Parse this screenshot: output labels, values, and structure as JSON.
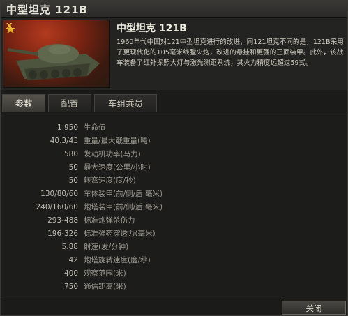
{
  "window": {
    "title": "中型坦克 121B"
  },
  "header": {
    "badge_text": "X",
    "tank_name": "中型坦克 121B",
    "description": "1960年代中国对121中型坦克进行的改进，同121坦克不同的是，121B采用了更现代化的105毫米线膛火炮，改进的悬挂和更强的正面装甲。此外，该战车装备了红外探照大灯与激光测距系统，其火力精度远超过59式。"
  },
  "tabs": [
    {
      "label": "参数"
    },
    {
      "label": "配置"
    },
    {
      "label": "车组乘员"
    }
  ],
  "stats": [
    {
      "value": "1,950",
      "label": "生命值"
    },
    {
      "value": "40.3/43",
      "label": "重量/最大载重量(吨)"
    },
    {
      "value": "580",
      "label": "发动机功率(马力)"
    },
    {
      "value": "50",
      "label": "最大速度(公里/小时)"
    },
    {
      "value": "50",
      "label": "转弯速度(度/秒)"
    },
    {
      "value": "130/80/60",
      "label": "车体装甲(前/侧/后 毫米)"
    },
    {
      "value": "240/160/60",
      "label": "炮塔装甲(前/侧/后 毫米)"
    },
    {
      "value": "293-488",
      "label": "标准炮弹杀伤力"
    },
    {
      "value": "196-326",
      "label": "标准弹药穿透力(毫米)"
    },
    {
      "value": "5.88",
      "label": "射速(发/分钟)"
    },
    {
      "value": "42",
      "label": "炮塔旋转速度(度/秒)"
    },
    {
      "value": "400",
      "label": "观察范围(米)"
    },
    {
      "value": "750",
      "label": "通信距离(米)"
    }
  ],
  "footer": {
    "close_label": "关闭"
  }
}
